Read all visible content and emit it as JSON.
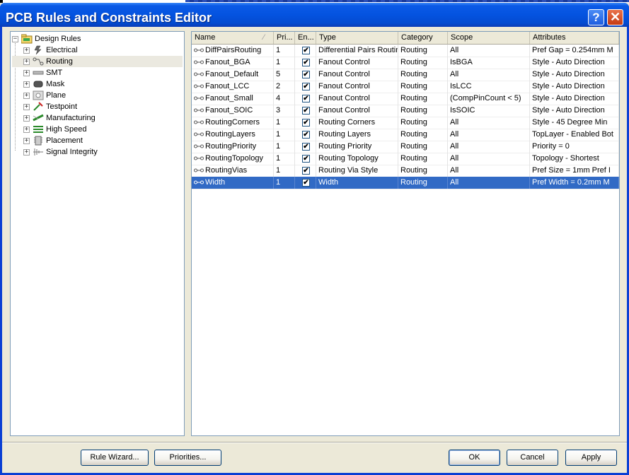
{
  "window": {
    "title": "PCB Rules and Constraints Editor",
    "help_glyph": "?",
    "close_glyph": "✕"
  },
  "tree": {
    "root_label": "Design Rules",
    "items": [
      {
        "label": "Electrical",
        "icon": "electrical-icon"
      },
      {
        "label": "Routing",
        "icon": "routing-icon"
      },
      {
        "label": "SMT",
        "icon": "smt-icon"
      },
      {
        "label": "Mask",
        "icon": "mask-icon"
      },
      {
        "label": "Plane",
        "icon": "plane-icon"
      },
      {
        "label": "Testpoint",
        "icon": "testpoint-icon"
      },
      {
        "label": "Manufacturing",
        "icon": "manufacturing-icon"
      },
      {
        "label": "High Speed",
        "icon": "high-speed-icon"
      },
      {
        "label": "Placement",
        "icon": "placement-icon"
      },
      {
        "label": "Signal Integrity",
        "icon": "signal-integrity-icon"
      }
    ],
    "selected": "Routing"
  },
  "grid": {
    "columns": [
      "Name",
      "Pri...",
      "En...",
      "Type",
      "Category",
      "Scope",
      "Attributes"
    ],
    "sort_glyph": "⁄",
    "check_glyph": "✔",
    "rows": [
      {
        "name": "DiffPairsRouting",
        "priority": "1",
        "enabled": true,
        "type": "Differential Pairs Routing",
        "category": "Routing",
        "scope": "All",
        "attributes": "Pref Gap = 0.254mm    M"
      },
      {
        "name": "Fanout_BGA",
        "priority": "1",
        "enabled": true,
        "type": "Fanout Control",
        "category": "Routing",
        "scope": "IsBGA",
        "attributes": "Style - Auto    Direction"
      },
      {
        "name": "Fanout_Default",
        "priority": "5",
        "enabled": true,
        "type": "Fanout Control",
        "category": "Routing",
        "scope": "All",
        "attributes": "Style - Auto    Direction"
      },
      {
        "name": "Fanout_LCC",
        "priority": "2",
        "enabled": true,
        "type": "Fanout Control",
        "category": "Routing",
        "scope": "IsLCC",
        "attributes": "Style - Auto    Direction"
      },
      {
        "name": "Fanout_Small",
        "priority": "4",
        "enabled": true,
        "type": "Fanout Control",
        "category": "Routing",
        "scope": "(CompPinCount < 5)",
        "attributes": "Style - Auto    Direction"
      },
      {
        "name": "Fanout_SOIC",
        "priority": "3",
        "enabled": true,
        "type": "Fanout Control",
        "category": "Routing",
        "scope": "IsSOIC",
        "attributes": "Style - Auto    Direction"
      },
      {
        "name": "RoutingCorners",
        "priority": "1",
        "enabled": true,
        "type": "Routing Corners",
        "category": "Routing",
        "scope": "All",
        "attributes": "Style - 45 Degree    Min"
      },
      {
        "name": "RoutingLayers",
        "priority": "1",
        "enabled": true,
        "type": "Routing Layers",
        "category": "Routing",
        "scope": "All",
        "attributes": "TopLayer - Enabled Bot"
      },
      {
        "name": "RoutingPriority",
        "priority": "1",
        "enabled": true,
        "type": "Routing Priority",
        "category": "Routing",
        "scope": "All",
        "attributes": "Priority = 0"
      },
      {
        "name": "RoutingTopology",
        "priority": "1",
        "enabled": true,
        "type": "Routing Topology",
        "category": "Routing",
        "scope": "All",
        "attributes": "Topology - Shortest"
      },
      {
        "name": "RoutingVias",
        "priority": "1",
        "enabled": true,
        "type": "Routing Via Style",
        "category": "Routing",
        "scope": "All",
        "attributes": "Pref Size = 1mm    Pref I"
      },
      {
        "name": "Width",
        "priority": "1",
        "enabled": true,
        "type": "Width",
        "category": "Routing",
        "scope": "All",
        "attributes": "Pref Width = 0.2mm    M",
        "selected": true
      }
    ]
  },
  "buttons": {
    "rule_wizard": "Rule Wizard...",
    "priorities": "Priorities...",
    "ok": "OK",
    "cancel": "Cancel",
    "apply": "Apply"
  },
  "colors": {
    "title_bar": "#0453e0",
    "selection": "#316ac5",
    "dialog_face": "#ece9d8"
  }
}
